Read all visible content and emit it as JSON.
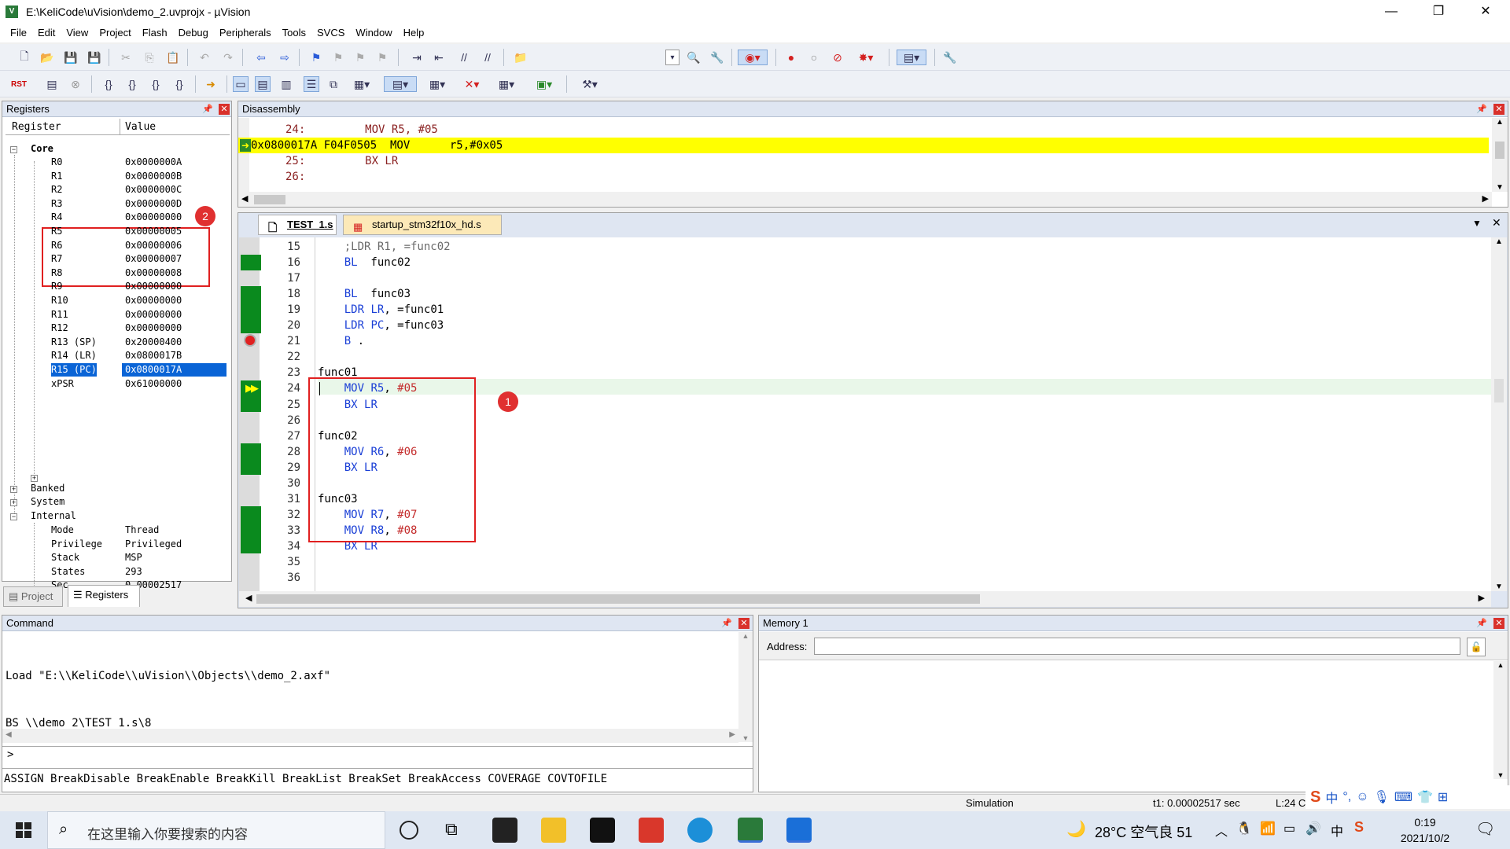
{
  "window": {
    "title": "E:\\KeliCode\\uVision\\demo_2.uvprojx - µVision",
    "app_icon": "V",
    "minimize": "—",
    "restore": "❐",
    "close": "✕"
  },
  "menu": [
    "File",
    "Edit",
    "View",
    "Project",
    "Flash",
    "Debug",
    "Peripherals",
    "Tools",
    "SVCS",
    "Window",
    "Help"
  ],
  "registers": {
    "title": "Registers",
    "col_register": "Register",
    "col_value": "Value",
    "core_label": "Core",
    "rows": [
      {
        "name": "R0",
        "value": "0x0000000A"
      },
      {
        "name": "R1",
        "value": "0x0000000B"
      },
      {
        "name": "R2",
        "value": "0x0000000C"
      },
      {
        "name": "R3",
        "value": "0x0000000D"
      },
      {
        "name": "R4",
        "value": "0x00000000"
      },
      {
        "name": "R5",
        "value": "0x00000005"
      },
      {
        "name": "R6",
        "value": "0x00000006"
      },
      {
        "name": "R7",
        "value": "0x00000007"
      },
      {
        "name": "R8",
        "value": "0x00000008"
      },
      {
        "name": "R9",
        "value": "0x00000000"
      },
      {
        "name": "R10",
        "value": "0x00000000"
      },
      {
        "name": "R11",
        "value": "0x00000000"
      },
      {
        "name": "R12",
        "value": "0x00000000"
      },
      {
        "name": "R13 (SP)",
        "value": "0x20000400"
      },
      {
        "name": "R14 (LR)",
        "value": "0x0800017B"
      },
      {
        "name": "R15 (PC)",
        "value": "0x0800017A"
      },
      {
        "name": "xPSR",
        "value": "0x61000000"
      }
    ],
    "groups": [
      "Banked",
      "System",
      "Internal"
    ],
    "internal": [
      {
        "name": "Mode",
        "value": "Thread"
      },
      {
        "name": "Privilege",
        "value": "Privileged"
      },
      {
        "name": "Stack",
        "value": "MSP"
      },
      {
        "name": "States",
        "value": "293"
      },
      {
        "name": "Sec",
        "value": "0.00002517"
      }
    ],
    "badge": "2",
    "tab_project": "Project",
    "tab_registers": "Registers"
  },
  "disassembly": {
    "title": "Disassembly",
    "lines": [
      "24:         MOV R5, #05",
      "0x0800017A F04F0505  MOV      r5,#0x05",
      "25:         BX LR",
      "26:"
    ]
  },
  "editor": {
    "tab_active": "TEST_1.s",
    "tab_other": "startup_stm32f10x_hd.s",
    "badge": "1",
    "lines": [
      {
        "n": "15",
        "code": "    ;LDR R1, =func02"
      },
      {
        "n": "16",
        "code": "    BL  func02"
      },
      {
        "n": "17",
        "code": ""
      },
      {
        "n": "18",
        "code": "    BL  func03"
      },
      {
        "n": "19",
        "code": "    LDR LR, =func01"
      },
      {
        "n": "20",
        "code": "    LDR PC, =func03"
      },
      {
        "n": "21",
        "code": "    B ."
      },
      {
        "n": "22",
        "code": ""
      },
      {
        "n": "23",
        "code": "func01"
      },
      {
        "n": "24",
        "code": "    MOV R5, #05"
      },
      {
        "n": "25",
        "code": "    BX LR"
      },
      {
        "n": "26",
        "code": ""
      },
      {
        "n": "27",
        "code": "func02"
      },
      {
        "n": "28",
        "code": "    MOV R6, #06"
      },
      {
        "n": "29",
        "code": "    BX LR"
      },
      {
        "n": "30",
        "code": ""
      },
      {
        "n": "31",
        "code": "func03"
      },
      {
        "n": "32",
        "code": "    MOV R7, #07"
      },
      {
        "n": "33",
        "code": "    MOV R8, #08"
      },
      {
        "n": "34",
        "code": "    BX LR"
      },
      {
        "n": "35",
        "code": ""
      },
      {
        "n": "36",
        "code": ""
      }
    ]
  },
  "command": {
    "title": "Command",
    "lines": [
      "Load \"E:\\\\KeliCode\\\\uVision\\\\Objects\\\\demo_2.axf\"",
      "BS \\\\demo_2\\TEST_1.s\\8"
    ],
    "prompt": ">",
    "hints": "ASSIGN BreakDisable BreakEnable BreakKill BreakList BreakSet BreakAccess COVERAGE COVTOFILE"
  },
  "memory": {
    "title": "Memory 1",
    "address_label": "Address:",
    "address_value": ""
  },
  "status": {
    "mode": "Simulation",
    "time": "t1: 0.00002517 sec",
    "pos": "L:24 C:"
  },
  "taskbar": {
    "search_placeholder": "在这里输入你要搜索的内容",
    "weather": "28°C 空气良 51",
    "time": "0:19",
    "date": "2021/10/2",
    "ime_lang": "中"
  }
}
